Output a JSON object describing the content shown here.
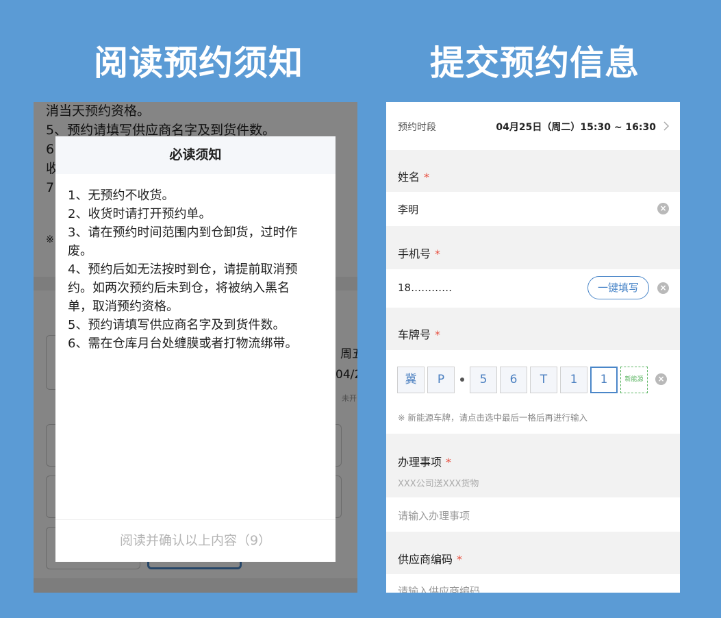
{
  "headlines": {
    "left": "阅读预约须知",
    "right": "提交预约信息"
  },
  "background_page": {
    "lines": [
      "消当天预约资格。",
      "5、预约请填写供应商名字及到货件数。",
      "6",
      "收",
      "7"
    ],
    "partial_texts": {
      "weekday": "周五",
      "date": "04/2",
      "sub": "未开",
      "note_mark": "※"
    }
  },
  "notice_modal": {
    "title": "必读须知",
    "lines": [
      "1、无预约不收货。",
      "2、收货时请打开预约单。",
      "3、请在预约时间范围内到仓卸货，过时作",
      "废。",
      "4、预约后如无法按时到仓，请提前取消预",
      "约。如两次预约后未到仓，将被纳入黑名",
      "单，取消预约资格。",
      "5、预约请填写供应商名字及到货件数。",
      "6、需在仓库月台处缠膜或者打物流绑带。"
    ],
    "confirm_label": "阅读并确认以上内容（9）"
  },
  "form": {
    "time_slot": {
      "label": "预约时段",
      "value": "04月25日（周二）15:30 ~ 16:30"
    },
    "name": {
      "label": "姓名",
      "required_mark": "*",
      "value": "李明"
    },
    "phone": {
      "label": "手机号",
      "required_mark": "*",
      "value": "18…………",
      "autofill_label": "一键填写"
    },
    "plate": {
      "label": "车牌号",
      "required_mark": "*",
      "chars": [
        "冀",
        "P",
        "5",
        "6",
        "T",
        "1",
        "1"
      ],
      "ev_label": "新能源",
      "hint": "※ 新能源车牌，请点击选中最后一格后再进行输入"
    },
    "matter": {
      "label": "办理事项",
      "required_mark": "*",
      "example": "XXX公司送XXX货物",
      "placeholder": "请输入办理事项"
    },
    "supplier_code": {
      "label": "供应商编码",
      "required_mark": "*",
      "placeholder": "请输入供应商编码"
    }
  },
  "colors": {
    "page_background": "#5b9bd5",
    "required": "#e74c3c",
    "plate_text": "#4a7fc0",
    "ev_green": "#57b35e",
    "autofill_border": "#4a86c8"
  },
  "icons": {
    "chevron": "chevron-right-icon",
    "clear": "clear-circle-icon"
  }
}
